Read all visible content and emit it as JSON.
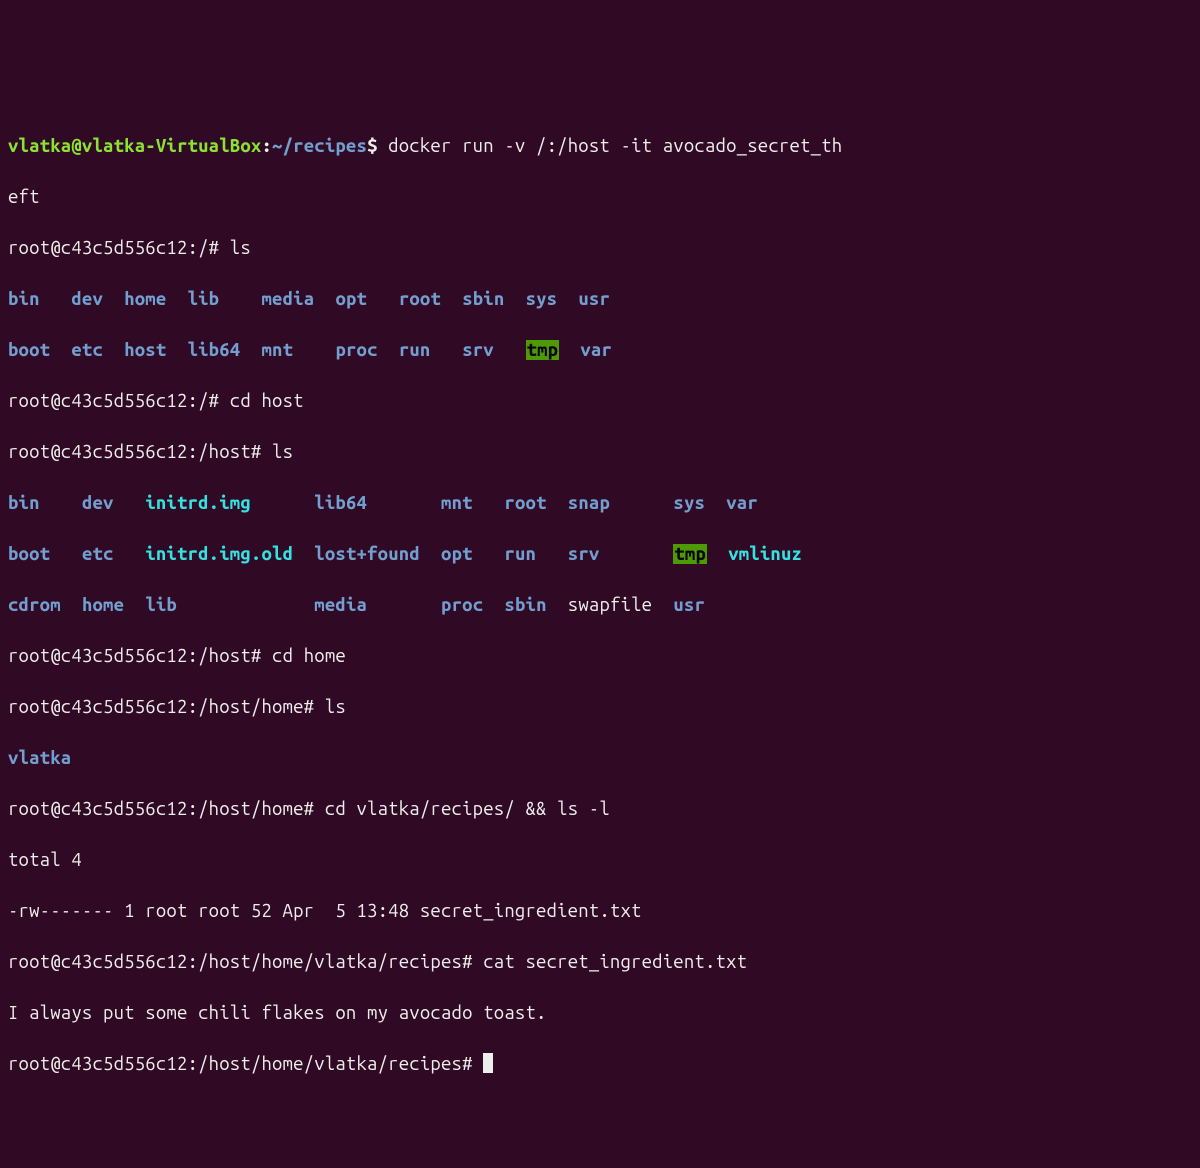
{
  "prompt_initial": {
    "user": "vlatka@vlatka-VirtualBox",
    "sep1": ":",
    "path": "~/recipes",
    "sep2": "$",
    "cmd_part1": " docker run -v /:/host -it avocado_secret_th",
    "cmd_wrap": "eft"
  },
  "p1": {
    "prefix": "root@c43c5d556c12:/#",
    "cmd": " ls"
  },
  "ls_root_l1": {
    "c0": "bin",
    "s0": "   ",
    "c1": "dev",
    "s1": "  ",
    "c2": "home",
    "s2": "  ",
    "c3": "lib",
    "s3": "    ",
    "c4": "media",
    "s4": "  ",
    "c5": "opt",
    "s5": "   ",
    "c6": "root",
    "s6": "  ",
    "c7": "sbin",
    "s7": "  ",
    "c8": "sys",
    "s8": "  ",
    "c9": "usr"
  },
  "ls_root_l2": {
    "c0": "boot",
    "s0": "  ",
    "c1": "etc",
    "s1": "  ",
    "c2": "host",
    "s2": "  ",
    "c3": "lib64",
    "s3": "  ",
    "c4": "mnt",
    "s4": "    ",
    "c5": "proc",
    "s5": "  ",
    "c6": "run",
    "s6": "   ",
    "c7": "srv",
    "s7": "   ",
    "c8": "tmp",
    "s8": "  ",
    "c9": "var"
  },
  "p2": {
    "prefix": "root@c43c5d556c12:/#",
    "cmd": " cd host"
  },
  "p3": {
    "prefix": "root@c43c5d556c12:/host#",
    "cmd": " ls"
  },
  "ls_host_l1": {
    "c0": "bin",
    "s0": "    ",
    "c1": "dev",
    "s1": "   ",
    "c2": "initrd.img",
    "s2": "      ",
    "c3": "lib64",
    "s3": "       ",
    "c4": "mnt",
    "s4": "   ",
    "c5": "root",
    "s5": "  ",
    "c6": "snap",
    "s6": "      ",
    "c7": "sys",
    "s7": "  ",
    "c8": "var"
  },
  "ls_host_l2": {
    "c0": "boot",
    "s0": "   ",
    "c1": "etc",
    "s1": "   ",
    "c2": "initrd.img.old",
    "s2": "  ",
    "c3": "lost+found",
    "s3": "  ",
    "c4": "opt",
    "s4": "   ",
    "c5": "run",
    "s5": "   ",
    "c6": "srv",
    "s6": "       ",
    "c7": "tmp",
    "s7": "  ",
    "c8": "vmlinuz"
  },
  "ls_host_l3": {
    "c0": "cdrom",
    "s0": "  ",
    "c1": "home",
    "s1": "  ",
    "c2": "lib",
    "s2": "             ",
    "c3": "media",
    "s3": "       ",
    "c4": "proc",
    "s4": "  ",
    "c5": "sbin",
    "s5": "  ",
    "c6": "swapfile",
    "s6": "  ",
    "c7": "usr"
  },
  "p4": {
    "prefix": "root@c43c5d556c12:/host#",
    "cmd": " cd home"
  },
  "p5": {
    "prefix": "root@c43c5d556c12:/host/home#",
    "cmd": " ls"
  },
  "ls_home": "vlatka",
  "p6": {
    "prefix": "root@c43c5d556c12:/host/home#",
    "cmd": " cd vlatka/recipes/ && ls -l"
  },
  "total": "total 4",
  "lsl": "-rw------- 1 root root 52 Apr  5 13:48 secret_ingredient.txt",
  "p7": {
    "prefix": "root@c43c5d556c12:/host/home/vlatka/recipes#",
    "cmd": " cat secret_ingredient.txt"
  },
  "filecontent": "I always put some chili flakes on my avocado toast.",
  "p8": {
    "prefix": "root@c43c5d556c12:/host/home/vlatka/recipes#",
    "cmd": " "
  }
}
